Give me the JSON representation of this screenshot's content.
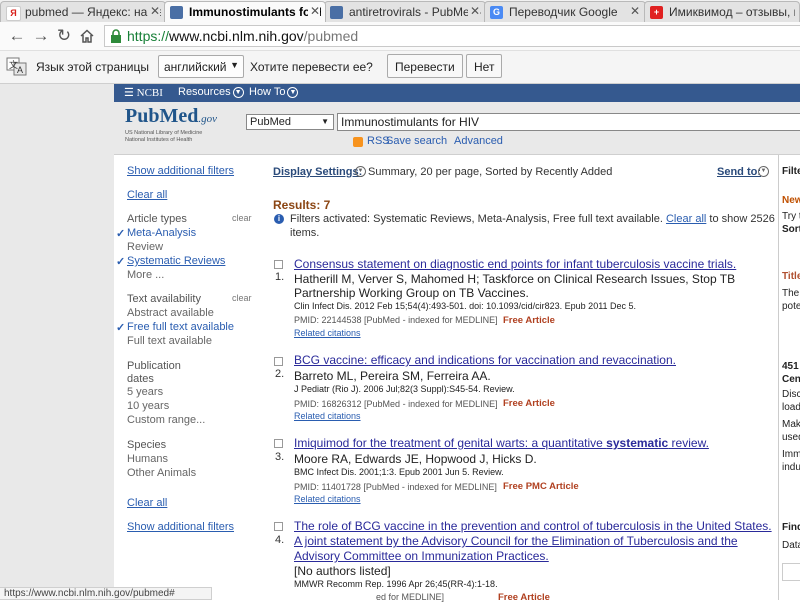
{
  "tabs": [
    {
      "label": "pubmed — Яндекс: нашё",
      "favicon": "Я",
      "color": "#ffffff",
      "fg": "#d8201b"
    },
    {
      "label": "Immunostimulants for HIV",
      "favicon": "pm",
      "color": "#4a6fa5",
      "fg": "#ffffff"
    },
    {
      "label": "antiretrovirals - PubMed -",
      "favicon": "pm",
      "color": "#4a6fa5",
      "fg": "#ffffff"
    },
    {
      "label": "Переводчик Google",
      "favicon": "G",
      "color": "#4a8af4",
      "fg": "#ffffff"
    },
    {
      "label": "Имиквимод – отзывы, ин",
      "favicon": "+",
      "color": "#e02020",
      "fg": "#ffffff"
    }
  ],
  "url": {
    "proto": "https://",
    "host": "www.ncbi.nlm.nih.gov",
    "path": "/pubmed"
  },
  "translate": {
    "label": "Язык этой страницы",
    "language": "английский",
    "question": "Хотите перевести ее?",
    "translate_button": "Перевести",
    "no_button": "Нет"
  },
  "ncbi": {
    "logo": "NCBI",
    "resources": "Resources",
    "howto": "How To"
  },
  "pubmed_logo": {
    "pub": "Pub",
    "med": "Med",
    "gov": ".gov",
    "line1": "US National Library of Medicine",
    "line2": "National Institutes of Health"
  },
  "search": {
    "database": "PubMed",
    "query": "Immunostimulants for HIV",
    "rss": "RSS",
    "save": "Save search",
    "advanced": "Advanced"
  },
  "filters": {
    "show_additional": "Show additional filters",
    "clear_all": "Clear all",
    "clear": "clear",
    "article_types": "Article types",
    "meta_analysis": "Meta-Analysis",
    "review": "Review",
    "systematic_reviews": "Systematic Reviews",
    "more": "More ...",
    "text_availability": "Text availability",
    "abstract_available": "Abstract available",
    "free_full_text": "Free full text available",
    "full_text": "Full text available",
    "pub_dates_1": "Publication",
    "pub_dates_2": "dates",
    "five_years": "5 years",
    "ten_years": "10 years",
    "custom_range": "Custom range...",
    "species": "Species",
    "humans": "Humans",
    "other_animals": "Other Animals"
  },
  "display": {
    "label": "Display Settings:",
    "summary": "Summary, 20 per page, Sorted by Recently Added",
    "send_to": "Send to:"
  },
  "results": {
    "count": "Results: 7",
    "filter_text": "Filters activated: Systematic Reviews, Meta-Analysis, Free full text available.",
    "clear_all": "Clear all",
    "show_text": "to show 2526",
    "items": "items."
  },
  "articles": [
    {
      "num": "1.",
      "title": "Consensus statement on diagnostic end points for infant tuberculosis vaccine trials.",
      "authors": "Hatherill M, Verver S, Mahomed H; Taskforce on Clinical Research Issues, Stop TB Partnership Working Group on TB Vaccines.",
      "source": "Clin Infect Dis. 2012 Feb 15;54(4):493-501. doi: 10.1093/cid/cir823. Epub 2011 Dec 5.",
      "pmid": "PMID: 22144538 [PubMed - indexed for MEDLINE]",
      "free": "Free Article",
      "related": "Related citations"
    },
    {
      "num": "2.",
      "title": "BCG vaccine: efficacy and indications for vaccination and revaccination.",
      "authors": "Barreto ML, Pereira SM, Ferreira AA.",
      "source": "J Pediatr (Rio J). 2006 Jul;82(3 Suppl):S45-54. Review.",
      "pmid": "PMID: 16826312 [PubMed - indexed for MEDLINE]",
      "free": "Free Article",
      "related": "Related citations"
    },
    {
      "num": "3.",
      "title": "Imiquimod for the treatment of genital warts: a quantitative ",
      "title_bold": "systematic",
      "title_end": " review.",
      "authors": "Moore RA, Edwards JE, Hopwood J, Hicks D.",
      "source": "BMC Infect Dis. 2001;1:3. Epub 2001 Jun 5. Review.",
      "pmid": "PMID: 11401728 [PubMed - indexed for MEDLINE]",
      "free": "Free PMC Article",
      "related": "Related citations"
    },
    {
      "num": "4.",
      "title": "The role of BCG vaccine in the prevention and control of tuberculosis in the United States. A joint statement by the Advisory Council for the Elimination of Tuberculosis and the Advisory Committee on Immunization Practices.",
      "authors": "[No authors listed]",
      "source": "MMWR Recomm Rep. 1996 Apr 26;45(RR-4):1-18.",
      "pmid": "ed for MEDLINE]",
      "free": "Free Article"
    }
  ],
  "sidebar": {
    "filter": "Filte",
    "new": "New",
    "try": "Try t",
    "sort": "Sort",
    "titles": "Title",
    "the": "The",
    "pote": "pote",
    "n451": "451",
    "cen": "Cen",
    "disc": "Disc",
    "load": "load",
    "make": "Make",
    "used": "used",
    "imm": "Imm",
    "indu": "indu",
    "find": "Find",
    "data": "Data"
  },
  "status": "https://www.ncbi.nlm.nih.gov/pubmed#"
}
